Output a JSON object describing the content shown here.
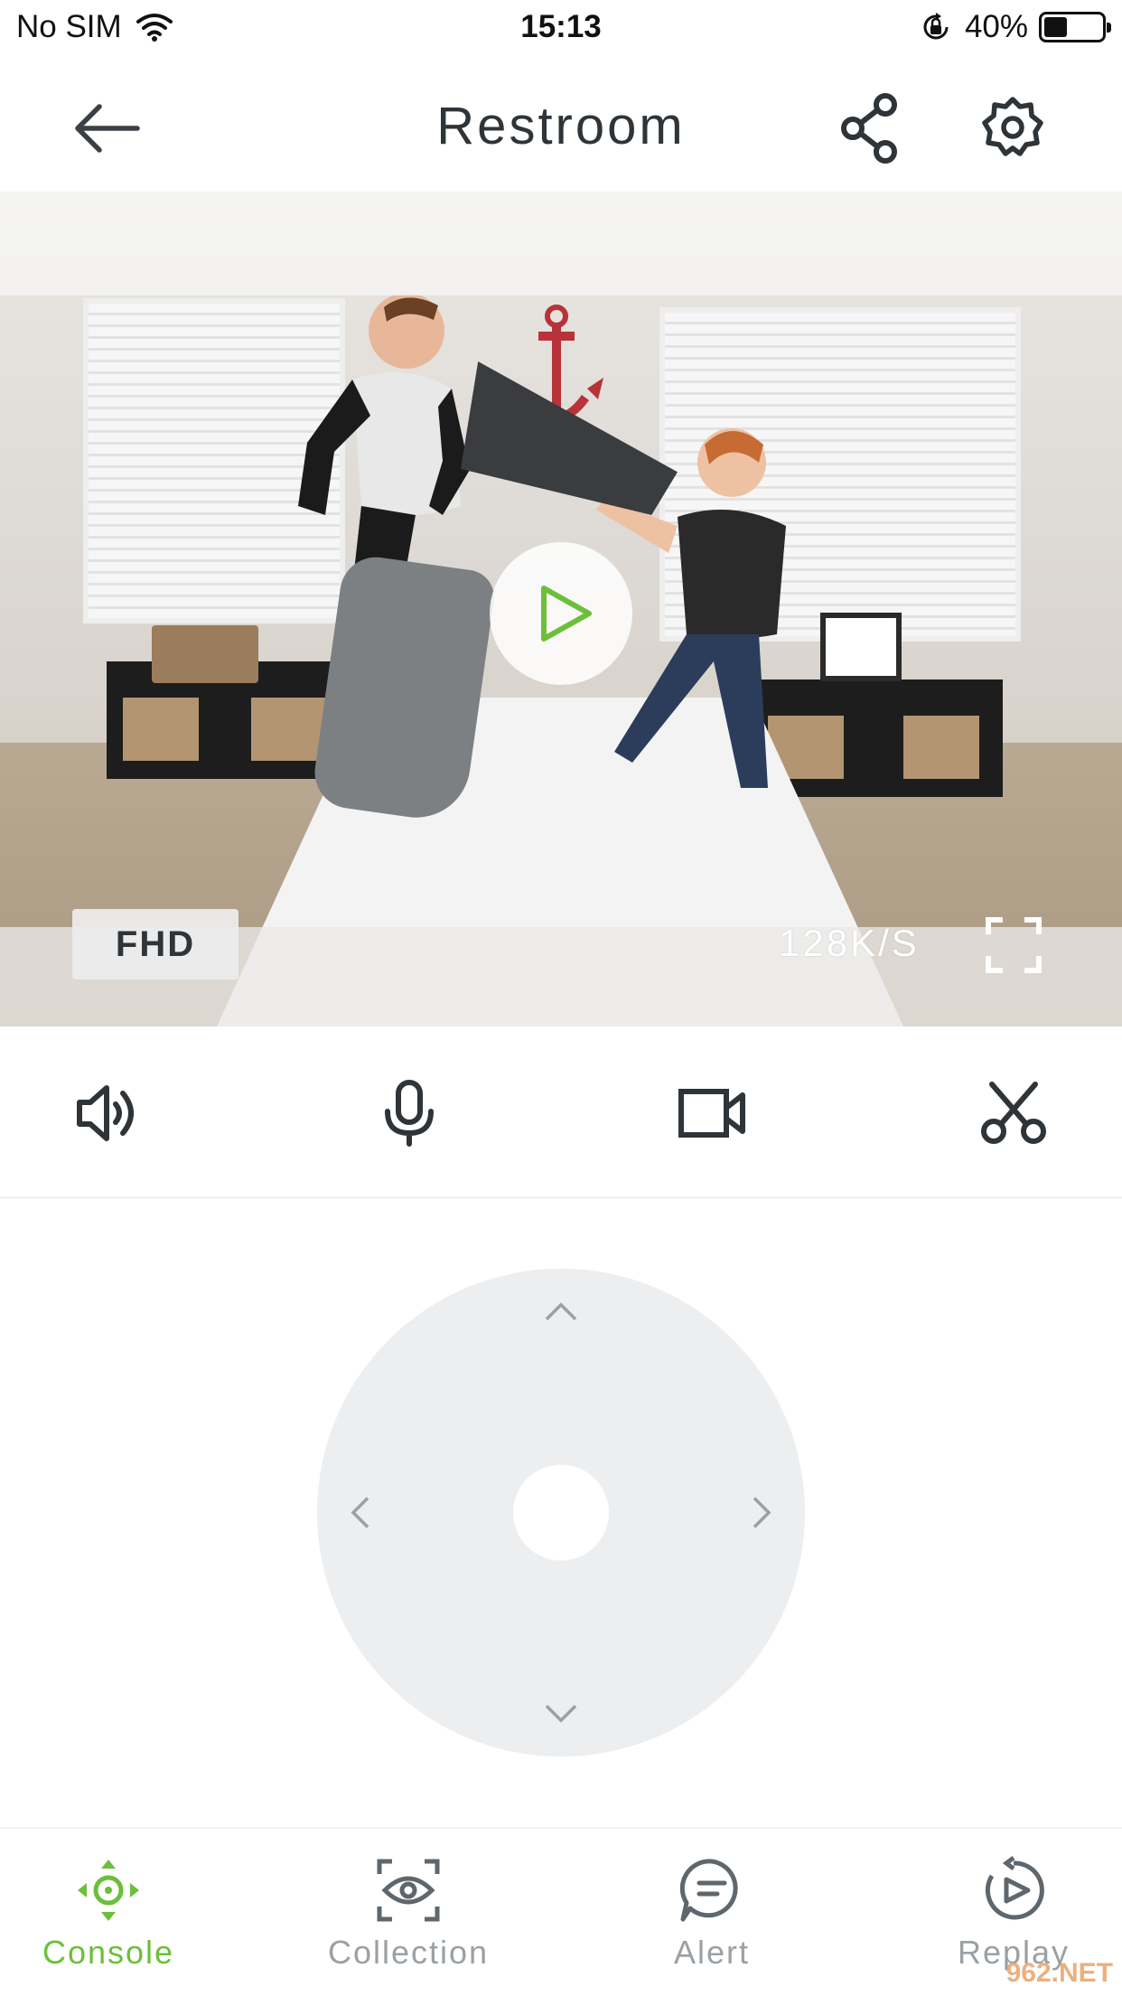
{
  "status_bar": {
    "carrier": "No SIM",
    "time": "15:13",
    "battery_percent_text": "40%",
    "battery_level": 0.4
  },
  "nav": {
    "title": "Restroom",
    "back_icon": "arrow-left-icon",
    "share_icon": "share-icon",
    "settings_icon": "gear-icon"
  },
  "video": {
    "quality": "FHD",
    "bitrate": "128K/S",
    "play_icon": "play-icon",
    "fullscreen_icon": "fullscreen-icon"
  },
  "controls": [
    {
      "name": "speaker",
      "icon": "speaker-icon"
    },
    {
      "name": "microphone",
      "icon": "microphone-icon"
    },
    {
      "name": "record",
      "icon": "video-camera-icon"
    },
    {
      "name": "screenshot",
      "icon": "scissors-icon"
    }
  ],
  "joystick": {
    "directions": [
      "up",
      "down",
      "left",
      "right"
    ]
  },
  "tabs": [
    {
      "label": "Console",
      "icon": "dpad-icon",
      "active": true
    },
    {
      "label": "Collection",
      "icon": "eye-scan-icon",
      "active": false
    },
    {
      "label": "Alert",
      "icon": "message-icon",
      "active": false
    },
    {
      "label": "Replay",
      "icon": "replay-icon",
      "active": false
    }
  ],
  "colors": {
    "accent_green": "#6cbf3a",
    "text_dark": "#2f3438",
    "inactive_gray": "#9aa0a4",
    "joystick_bg": "#eceef0"
  },
  "watermark": "962.NET"
}
